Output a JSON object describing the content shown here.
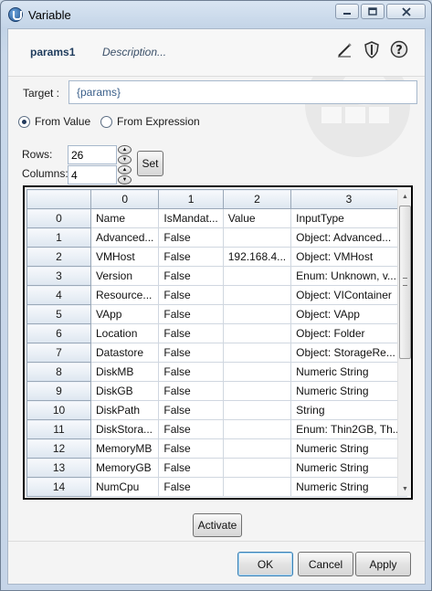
{
  "window": {
    "title": "Variable",
    "buttons": {
      "minimize": "minimize-icon",
      "maximize": "maximize-icon",
      "close": "close-icon"
    }
  },
  "header": {
    "tab_name": "params1",
    "tab_description": "Description...",
    "icons": [
      "edit-pencil-icon",
      "shield-icon",
      "help-icon"
    ]
  },
  "target": {
    "label": "Target :",
    "value": "{params}"
  },
  "source": {
    "from_value": {
      "label": "From Value",
      "selected": true
    },
    "from_expression": {
      "label": "From Expression",
      "selected": false
    }
  },
  "dimensions": {
    "rows_label": "Rows:",
    "rows_value": "26",
    "columns_label": "Columns:",
    "columns_value": "4",
    "set_label": "Set"
  },
  "grid": {
    "columns": [
      "",
      "0",
      "1",
      "2",
      "3"
    ],
    "rows": [
      [
        "0",
        "Name",
        "IsMandat...",
        "Value",
        "InputType"
      ],
      [
        "1",
        "Advanced...",
        "False",
        "",
        "Object: Advanced..."
      ],
      [
        "2",
        "VMHost",
        "False",
        "192.168.4...",
        "Object: VMHost"
      ],
      [
        "3",
        "Version",
        "False",
        "",
        "Enum: Unknown, v..."
      ],
      [
        "4",
        "Resource...",
        "False",
        "",
        "Object: VIContainer"
      ],
      [
        "5",
        "VApp",
        "False",
        "",
        "Object: VApp"
      ],
      [
        "6",
        "Location",
        "False",
        "",
        "Object: Folder"
      ],
      [
        "7",
        "Datastore",
        "False",
        "",
        "Object: StorageRe..."
      ],
      [
        "8",
        "DiskMB",
        "False",
        "",
        "Numeric String"
      ],
      [
        "9",
        "DiskGB",
        "False",
        "",
        "Numeric String"
      ],
      [
        "10",
        "DiskPath",
        "False",
        "",
        "String"
      ],
      [
        "11",
        "DiskStora...",
        "False",
        "",
        "Enum: Thin2GB, Th..."
      ],
      [
        "12",
        "MemoryMB",
        "False",
        "",
        "Numeric String"
      ],
      [
        "13",
        "MemoryGB",
        "False",
        "",
        "Numeric String"
      ],
      [
        "14",
        "NumCpu",
        "False",
        "",
        "Numeric String"
      ]
    ]
  },
  "actions": {
    "activate_label": "Activate",
    "ok_label": "OK",
    "cancel_label": "Cancel",
    "apply_label": "Apply"
  },
  "colors": {
    "frame": "#c6d5e8",
    "client": "#f4f4f4",
    "header_cell": "#dde6f0",
    "link_text": "#3a5f8a"
  }
}
